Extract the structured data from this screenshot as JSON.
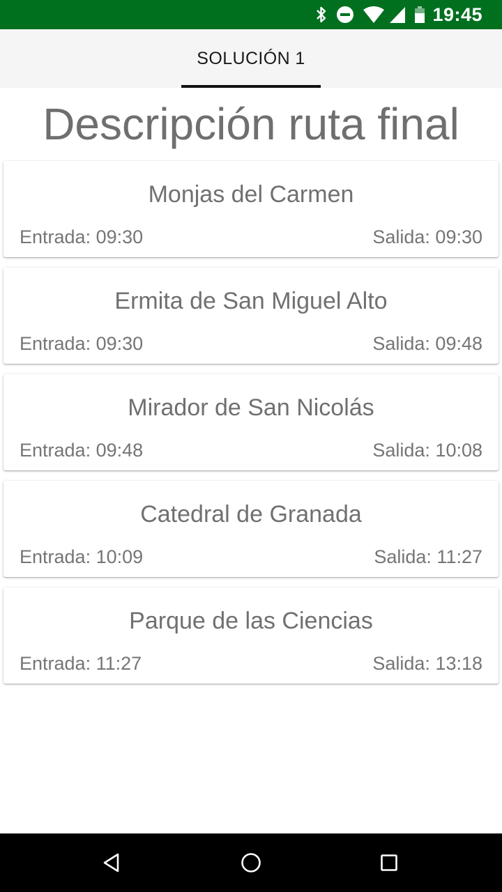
{
  "status_bar": {
    "time": "19:45",
    "icons": [
      "bluetooth-icon",
      "do-not-disturb-icon",
      "wifi-icon",
      "signal-icon",
      "battery-icon"
    ],
    "background": "#00701f"
  },
  "tabs": [
    {
      "label": "SOLUCIÓN 1",
      "selected": true
    }
  ],
  "page_title": "Descripción ruta final",
  "stops": [
    {
      "name": "Monjas del Carmen",
      "entry": "Entrada: 09:30",
      "exit": "Salida: 09:30"
    },
    {
      "name": "Ermita de San Miguel Alto",
      "entry": "Entrada: 09:30",
      "exit": "Salida: 09:48"
    },
    {
      "name": "Mirador de San Nicolás",
      "entry": "Entrada: 09:48",
      "exit": "Salida: 10:08"
    },
    {
      "name": "Catedral de Granada",
      "entry": "Entrada: 10:09",
      "exit": "Salida: 11:27"
    },
    {
      "name": "Parque de las Ciencias",
      "entry": "Entrada: 11:27",
      "exit": "Salida: 13:18"
    }
  ],
  "nav_bar": {
    "buttons": [
      "back-icon",
      "home-icon",
      "recents-icon"
    ]
  }
}
